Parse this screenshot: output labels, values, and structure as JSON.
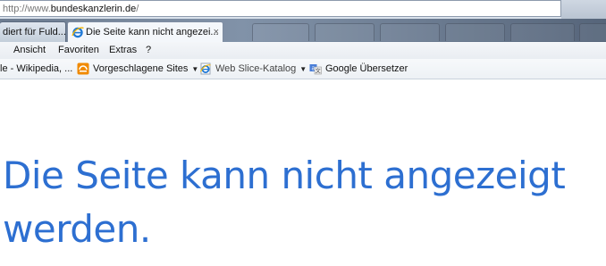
{
  "address_bar": {
    "prefix": "http://www.",
    "domain": "bundeskanzlerin.de",
    "suffix": "/"
  },
  "tabs": [
    {
      "label": "diert für Fuld...",
      "active": false
    },
    {
      "label": "Die Seite kann nicht angezei...",
      "active": true,
      "close": "×"
    }
  ],
  "menu": {
    "items": [
      "Ansicht",
      "Favoriten",
      "Extras",
      "?"
    ]
  },
  "favorites": {
    "items": [
      {
        "label": "le - Wikipedia, ...",
        "icon": "wikipedia-icon"
      },
      {
        "label": "Vorgeschlagene Sites",
        "icon": "suggested-sites-icon",
        "dropdown": "▼"
      },
      {
        "label": "Web Slice-Katalog",
        "icon": "ie-icon",
        "dropdown": "▼"
      },
      {
        "label": "Google Übersetzer",
        "icon": "google-translate-icon"
      }
    ]
  },
  "page": {
    "heading": "Die Seite kann nicht angezeigt werden."
  },
  "colors": {
    "heading": "#2d6fd1",
    "ie_blue": "#1e78d6",
    "suggested_orange": "#f08a00"
  }
}
